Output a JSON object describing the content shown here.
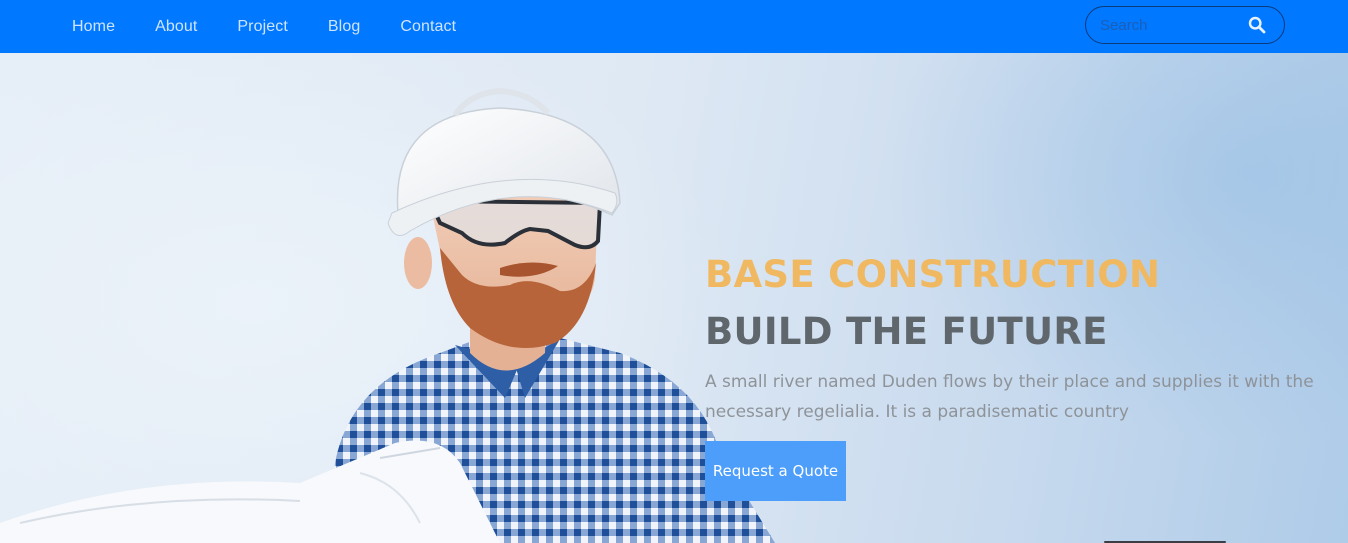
{
  "navbar": {
    "links": [
      "Home",
      "About",
      "Project",
      "Blog",
      "Contact"
    ],
    "search": {
      "placeholder": "Search",
      "icon": "search-icon"
    }
  },
  "hero": {
    "title": "BASE CONSTRUCTION",
    "subtitle": "BUILD THE FUTURE",
    "text": "A small river named Duden flows by their place and supplies it with the necessary regelialia. It is a paradisematic country",
    "button_label": "Request a Quote",
    "image": "construction-worker-photo"
  },
  "colors": {
    "navbar": "#0078ff",
    "title": "#f0b961",
    "subtitle": "#5f666c",
    "button": "#4d9efb"
  }
}
